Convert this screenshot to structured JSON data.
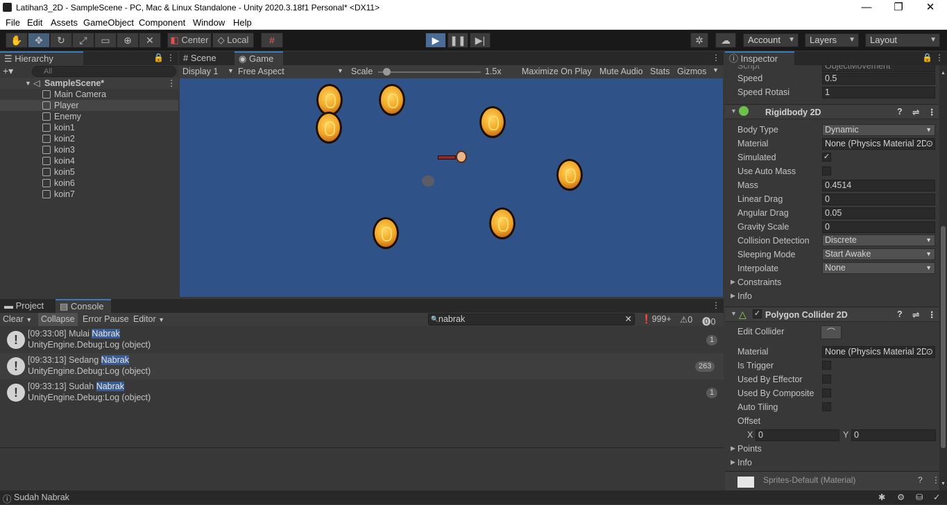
{
  "window": {
    "title": "Latihan3_2D - SampleScene - PC, Mac & Linux Standalone - Unity 2020.3.18f1 Personal* <DX11>",
    "min": "—",
    "max": "❐",
    "close": "✕"
  },
  "menu": [
    "File",
    "Edit",
    "Assets",
    "GameObject",
    "Component",
    "Window",
    "Help"
  ],
  "toolbar": {
    "center": "Center",
    "local": "Local",
    "account": "Account",
    "layers": "Layers",
    "layout": "Layout"
  },
  "hierarchy": {
    "tab": "Hierarchy",
    "search_placeholder": "All",
    "scene": "SampleScene*",
    "items": [
      "Main Camera",
      "Player",
      "Enemy",
      "koin1",
      "koin2",
      "koin3",
      "koin4",
      "koin5",
      "koin6",
      "koin7"
    ]
  },
  "game": {
    "tabs": [
      "Scene",
      "Game"
    ],
    "display": "Display 1",
    "aspect": "Free Aspect",
    "scale_label": "Scale",
    "scale_value": "1.5x",
    "scale_fraction": 0.08,
    "maximize": "Maximize On Play",
    "mute": "Mute Audio",
    "stats": "Stats",
    "gizmos": "Gizmos",
    "background": "#2f5289"
  },
  "console": {
    "tabs": [
      "Project",
      "Console"
    ],
    "buttons": {
      "clear": "Clear",
      "collapse": "Collapse",
      "error_pause": "Error Pause",
      "editor": "Editor"
    },
    "search": "nabrak",
    "counts": {
      "info": "999+",
      "warn": "0",
      "error": "0"
    },
    "logs": [
      {
        "prefix": "[09:33:08] Mulai ",
        "hl": "Nabrak",
        "sub": "UnityEngine.Debug:Log (object)",
        "count": "1"
      },
      {
        "prefix": "[09:33:13] Sedang ",
        "hl": "Nabrak",
        "sub": "UnityEngine.Debug:Log (object)",
        "count": "263"
      },
      {
        "prefix": "[09:33:13] Sudah ",
        "hl": "Nabrak",
        "sub": "UnityEngine.Debug:Log (object)",
        "count": "1"
      }
    ]
  },
  "inspector": {
    "tab": "Inspector",
    "script_label": "Script",
    "script_value": "ObjectMovement",
    "speed_label": "Speed",
    "speed_value": "0.5",
    "rot_label": "Speed Rotasi",
    "rot_value": "1",
    "rb": {
      "title": "Rigidbody 2D",
      "body_type_label": "Body Type",
      "body_type": "Dynamic",
      "material_label": "Material",
      "material": "None (Physics Material 2D)",
      "simulated_label": "Simulated",
      "auto_mass_label": "Use Auto Mass",
      "mass_label": "Mass",
      "mass": "0.4514",
      "linear_drag_label": "Linear Drag",
      "linear_drag": "0",
      "angular_drag_label": "Angular Drag",
      "angular_drag": "0.05",
      "gravity_label": "Gravity Scale",
      "gravity": "0",
      "collision_label": "Collision Detection",
      "collision": "Discrete",
      "sleeping_label": "Sleeping Mode",
      "sleeping": "Start Awake",
      "interpolate_label": "Interpolate",
      "interpolate": "None",
      "constraints": "Constraints",
      "info": "Info"
    },
    "pc": {
      "title": "Polygon Collider 2D",
      "edit_label": "Edit Collider",
      "material_label": "Material",
      "material": "None (Physics Material 2D)",
      "trigger_label": "Is Trigger",
      "effector_label": "Used By Effector",
      "composite_label": "Used By Composite",
      "tiling_label": "Auto Tiling",
      "offset_label": "Offset",
      "x_label": "X",
      "x": "0",
      "y_label": "Y",
      "y": "0",
      "points": "Points",
      "info": "Info"
    },
    "material_footer": "Sprites-Default (Material)"
  },
  "status": {
    "text": "Sudah Nabrak"
  }
}
